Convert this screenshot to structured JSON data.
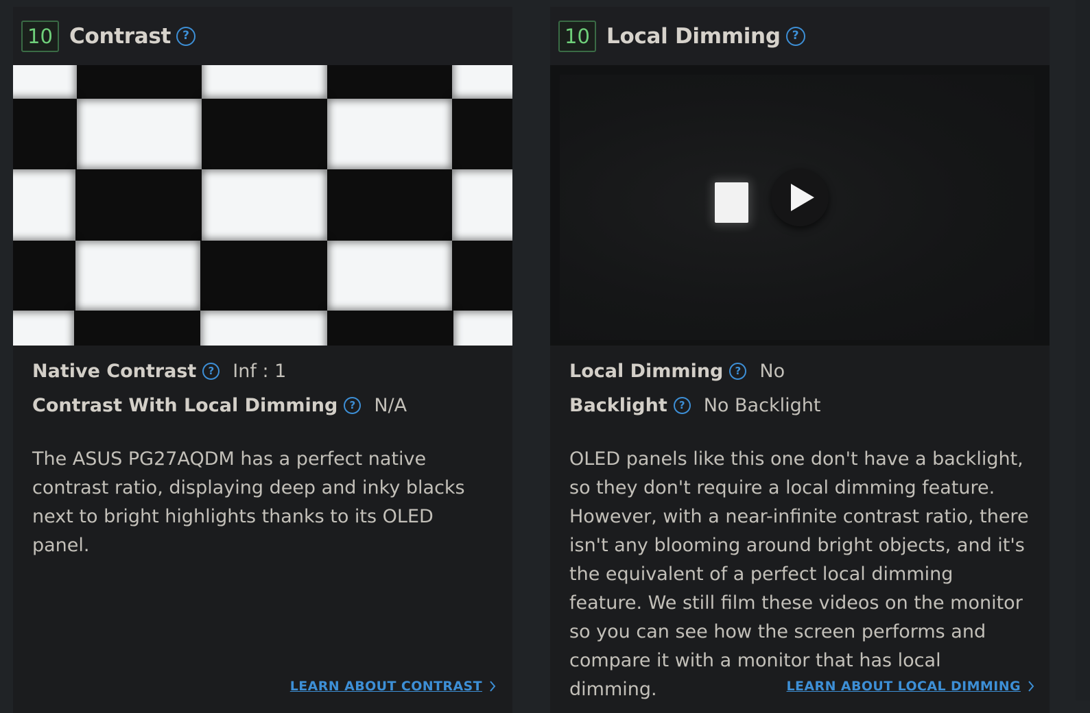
{
  "cards": [
    {
      "score": "10",
      "title": "Contrast",
      "specs": [
        {
          "label": "Native Contrast",
          "value": "Inf : 1"
        },
        {
          "label": "Contrast With Local Dimming",
          "value": "N/A"
        }
      ],
      "description": "The ASUS PG27AQDM has a perfect native contrast ratio, displaying deep and inky blacks next to bright highlights thanks to its OLED panel.",
      "link": "LEARN ABOUT CONTRAST"
    },
    {
      "score": "10",
      "title": "Local Dimming",
      "specs": [
        {
          "label": "Local Dimming",
          "value": "No"
        },
        {
          "label": "Backlight",
          "value": "No Backlight"
        }
      ],
      "description": "OLED panels like this one don't have a backlight, so they don't require a local dimming feature. However, with a near-infinite contrast ratio, there isn't any blooming around bright objects, and it's the equivalent of a perfect local dimming feature. We still film these videos on the monitor so you can see how the screen performs and compare it with a monitor that has local dimming.",
      "link": "LEARN ABOUT LOCAL DIMMING"
    }
  ],
  "help_glyph": "?",
  "icons": {
    "help": "question-circle-icon",
    "play": "play-icon",
    "chevron": "chevron-right-icon"
  },
  "colors": {
    "score_text": "#6fd07a",
    "score_border": "#3a6b45",
    "link": "#3d8fd6",
    "background": "#202326",
    "card": "#1b1c1e"
  }
}
